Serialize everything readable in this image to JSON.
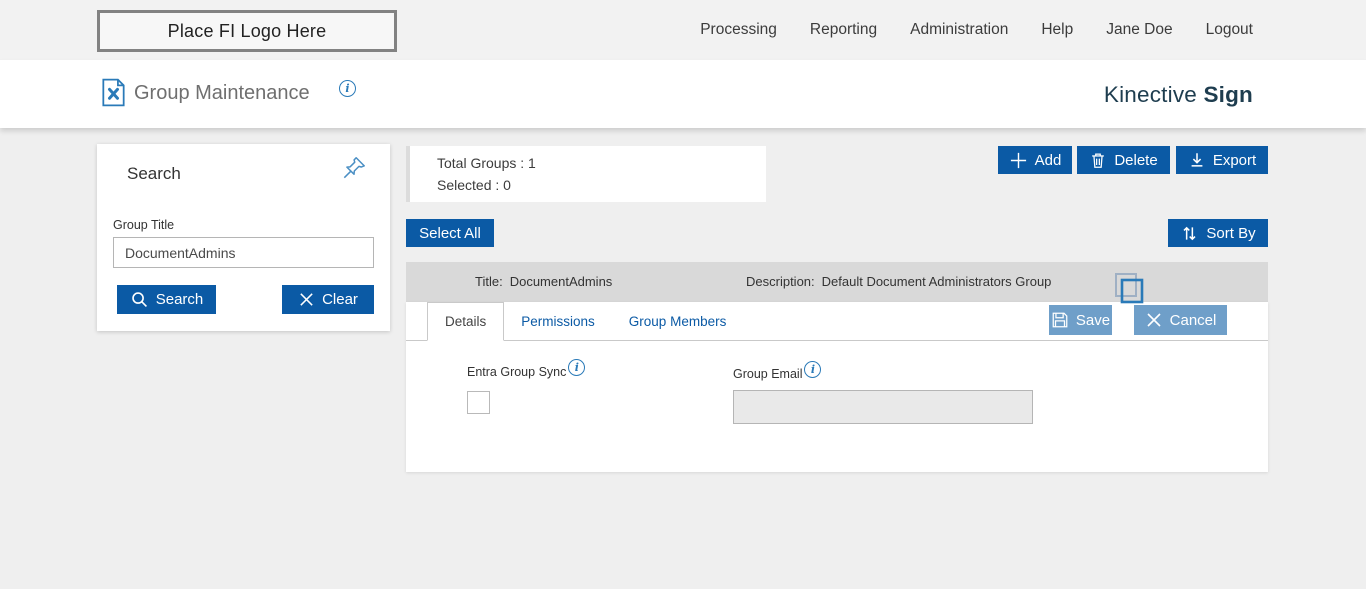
{
  "colors": {
    "primary_blue": "#0b5aa5",
    "muted_action_blue": "#6f9fc9",
    "icon_blue": "#2a7ab8",
    "brand_dark": "#1e3d4f",
    "row_gray": "#d9d9d9",
    "page_background": "#efefef"
  },
  "topbar": {
    "logo_placeholder": "Place FI Logo Here",
    "nav": [
      {
        "label": "Processing"
      },
      {
        "label": "Reporting"
      },
      {
        "label": "Administration"
      },
      {
        "label": "Help"
      },
      {
        "label": "Jane Doe"
      },
      {
        "label": "Logout"
      }
    ]
  },
  "header": {
    "page_title": "Group Maintenance",
    "brand_name": "Kinective",
    "brand_product": "Sign"
  },
  "search_panel": {
    "title": "Search",
    "group_title_label": "Group Title",
    "group_title_value": "DocumentAdmins",
    "search_button": "Search",
    "clear_button": "Clear"
  },
  "summary": {
    "total_groups_label": "Total Groups :",
    "total_groups_value": "1",
    "selected_label": "Selected :",
    "selected_value": "0"
  },
  "toolbar": {
    "add": "Add",
    "delete": "Delete",
    "export": "Export",
    "select_all": "Select All",
    "sort_by": "Sort By"
  },
  "group_row": {
    "title_label": "Title:",
    "title_value": "DocumentAdmins",
    "description_label": "Description:",
    "description_value": "Default Document Administrators Group"
  },
  "tabs": [
    {
      "label": "Details",
      "active": true
    },
    {
      "label": "Permissions",
      "active": false
    },
    {
      "label": "Group Members",
      "active": false
    }
  ],
  "actions": {
    "save": "Save",
    "cancel": "Cancel"
  },
  "details_form": {
    "entra_group_sync_label": "Entra Group Sync",
    "entra_group_sync_checked": false,
    "group_email_label": "Group Email",
    "group_email_value": ""
  },
  "icons": {
    "page": "document-with-tools",
    "info": "info-circle",
    "pin": "pushpin",
    "search": "magnifier",
    "clear": "x-mark",
    "add": "plus",
    "delete": "trash-can",
    "export": "download-arrow",
    "sort": "up-down-arrows",
    "copy": "overlapping-squares",
    "save": "floppy-disk",
    "cancel": "x-mark"
  }
}
